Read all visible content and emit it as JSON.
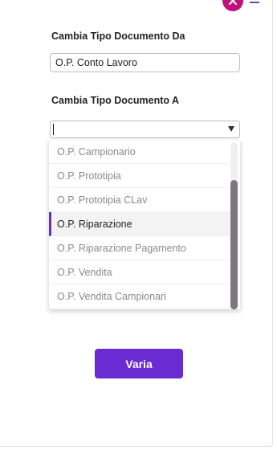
{
  "form": {
    "from_label": "Cambia Tipo Documento Da",
    "from_value": "O.P. Conto Lavoro",
    "to_label": "Cambia Tipo Documento A",
    "to_value": ""
  },
  "dropdown": {
    "options": [
      "O.P. Campionario",
      "O.P. Prototipia",
      "O.P. Prototipia CLav",
      "O.P. Riparazione",
      "O.P. Riparazione Pagamento",
      "O.P. Vendita",
      "O.P. Vendita Campionari"
    ],
    "highlighted": "O.P. Riparazione"
  },
  "submit_label": "Varia",
  "icons": {
    "close": "close-icon",
    "menu": "menu-icon",
    "select_arrow": "chevron-down-icon"
  },
  "colors": {
    "accent": "#6a2bd2",
    "close": "#c0127b"
  }
}
